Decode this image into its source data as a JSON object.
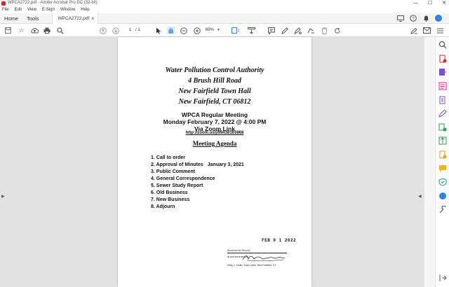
{
  "window": {
    "title": "WPCA2722.pdf - Adobe Acrobat Pro DC (32-bit)",
    "controls": [
      "—",
      "☐",
      "✕"
    ]
  },
  "menu": [
    "File",
    "Edit",
    "View",
    "E-Sign",
    "Window",
    "Help"
  ],
  "tabs": {
    "home": "Home",
    "tools": "Tools",
    "document": "WPCA2722.pdf"
  },
  "toolbar": {
    "page_current": "1",
    "page_total": "/ 1",
    "zoom": "69%"
  },
  "document": {
    "header": [
      "Water Pollution Control Authority",
      "4 Brush Hill Road",
      "New Fairfield Town Hall",
      "New Fairfield, CT 06812"
    ],
    "meeting": {
      "title": "WPCA Regular Meeting",
      "date": "Monday February 7, 2022 @ 4:00 PM",
      "via": "Via Zoom Link",
      "link": "http://zoom.us/j/99438163868"
    },
    "agenda_title": "Meeting Agenda",
    "agenda_items": [
      "1. Call to order",
      "2. Approval of Minutes   January 3, 2021",
      "3. Public Comment",
      "4. General Correspondence",
      "5. Sewer Study Report",
      "6. Old Business",
      "7. New Business",
      "8. Adjourn"
    ],
    "stamp": "FEB 0 1 2022",
    "received": {
      "line1": "Received for Record",
      "line2": "at         and recorded by",
      "line3": "Holly J. Smith, Town Clerk, New Fairfield, CT"
    }
  },
  "colors": {
    "acrobat_red": "#d8262f",
    "accent_blue": "#2b82e8",
    "doc_bg": "#e2e2e2"
  }
}
